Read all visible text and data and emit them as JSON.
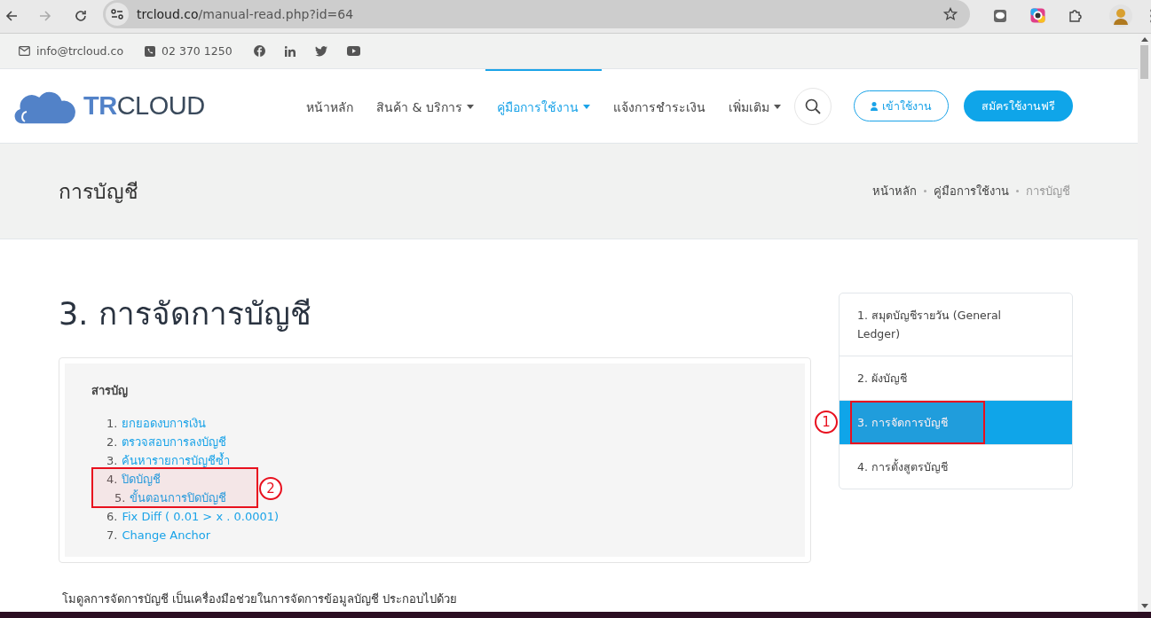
{
  "browser": {
    "url_host": "trcloud.co",
    "url_path": "/manual-read.php?id=64"
  },
  "topbar": {
    "email": "info@trcloud.co",
    "phone": "02 370 1250"
  },
  "header": {
    "logo": {
      "bold": "TR",
      "light": "CLOUD"
    },
    "nav": [
      {
        "label": "หน้าหลัก",
        "selected": false,
        "dropdown": false
      },
      {
        "label": "สินค้า & บริการ",
        "selected": false,
        "dropdown": true
      },
      {
        "label": "คู่มือการใช้งาน",
        "selected": true,
        "dropdown": true
      },
      {
        "label": "แจ้งการชำระเงิน",
        "selected": false,
        "dropdown": false
      },
      {
        "label": "เพิ่มเติม",
        "selected": false,
        "dropdown": true
      }
    ],
    "login_button": "เข้าใช้งาน",
    "signup_button": "สมัครใช้งานฟรี"
  },
  "banner": {
    "title": "การบัญชี",
    "breadcrumbs": [
      {
        "label": "หน้าหลัก",
        "current": false
      },
      {
        "label": "คู่มือการใช้งาน",
        "current": false
      },
      {
        "label": "การบัญชี",
        "current": true
      }
    ]
  },
  "article": {
    "title": "3. การจัดการบัญชี",
    "toc": {
      "heading": "สารบัญ",
      "items": [
        {
          "number": "1.",
          "label": "ยกยอดงบการเงิน"
        },
        {
          "number": "2.",
          "label": "ตรวจสอบการลงบัญชี"
        },
        {
          "number": "3.",
          "label": "ค้นหารายการบัญชีซ้ำ"
        },
        {
          "number": "4.",
          "label": "ปิดบัญชี",
          "callout": "2",
          "children": [
            {
              "number": "5.",
              "label": "ขั้นตอนการปิดบัญชี"
            }
          ]
        },
        {
          "number": "6.",
          "label": "Fix Diff ( 0.01 > x . 0.0001)"
        },
        {
          "number": "7.",
          "label": "Change Anchor"
        }
      ]
    },
    "intro": "โมดูลการจัดการบัญชี เป็นเครื่องมือช่วยในการจัดการข้อมูลบัญชี ประกอบไปด้วย"
  },
  "sidebar": {
    "items": [
      {
        "label": "1. สมุดบัญชีรายวัน (General Ledger)",
        "selected": false
      },
      {
        "label": "2. ผังบัญชี",
        "selected": false
      },
      {
        "label": "3. การจัดการบัญชี",
        "selected": true,
        "callout": "1"
      },
      {
        "label": "4. การตั้งสูตรบัญชี",
        "selected": false
      }
    ]
  }
}
